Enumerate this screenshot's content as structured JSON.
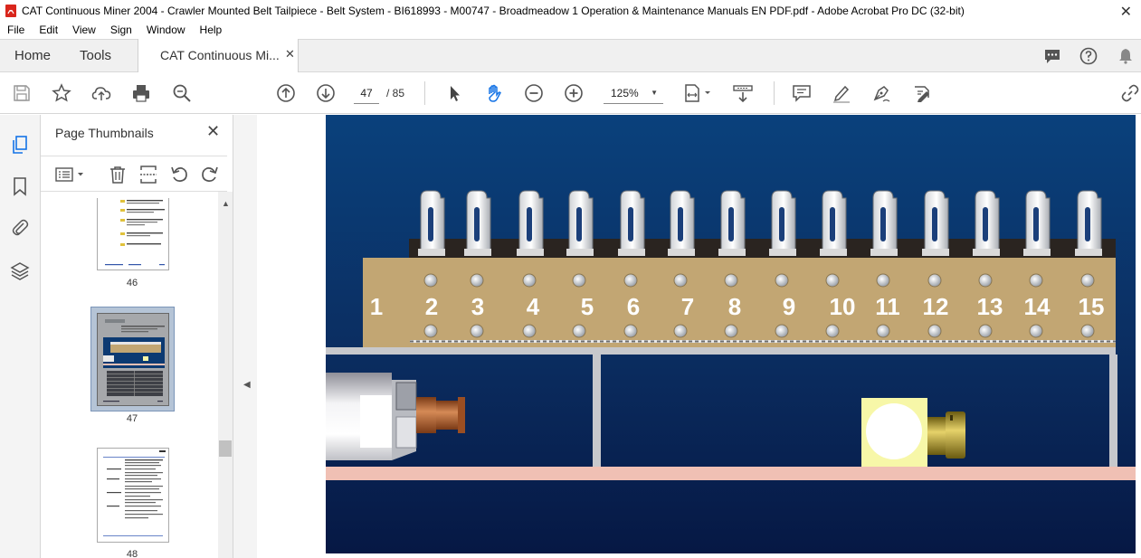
{
  "window": {
    "title": "CAT Continuous Miner 2004 - Crawler Mounted Belt Tailpiece - Belt System - BI618993 - M00747 - Broadmeadow 1 Operation & Maintenance Manuals EN PDF.pdf - Adobe Acrobat Pro DC (32-bit)",
    "close": "✕"
  },
  "menu": [
    "File",
    "Edit",
    "View",
    "Sign",
    "Window",
    "Help"
  ],
  "tabs": {
    "home": "Home",
    "tools": "Tools",
    "doc": "CAT Continuous Mi...",
    "doc_close": "✕"
  },
  "toolbar": {
    "page_current": "47",
    "page_total": "/ 85",
    "zoom": "125%"
  },
  "thumbnails": {
    "title": "Page Thumbnails",
    "close": "✕",
    "pages": [
      {
        "label": "46"
      },
      {
        "label": "47"
      },
      {
        "label": "48"
      }
    ]
  },
  "figure": {
    "terminals": [
      "1",
      "2",
      "3",
      "4",
      "5",
      "6",
      "7",
      "8",
      "9",
      "10",
      "11",
      "12",
      "13",
      "14",
      "15"
    ]
  },
  "colors": {
    "accent": "#1473e6",
    "figure_bg_top": "#0a3f7a",
    "figure_bg_bottom": "#061a45",
    "terminal_block": "#c2a673",
    "rail_pink": "#f0c0b4",
    "plug_yellow": "#f7f7a8"
  }
}
